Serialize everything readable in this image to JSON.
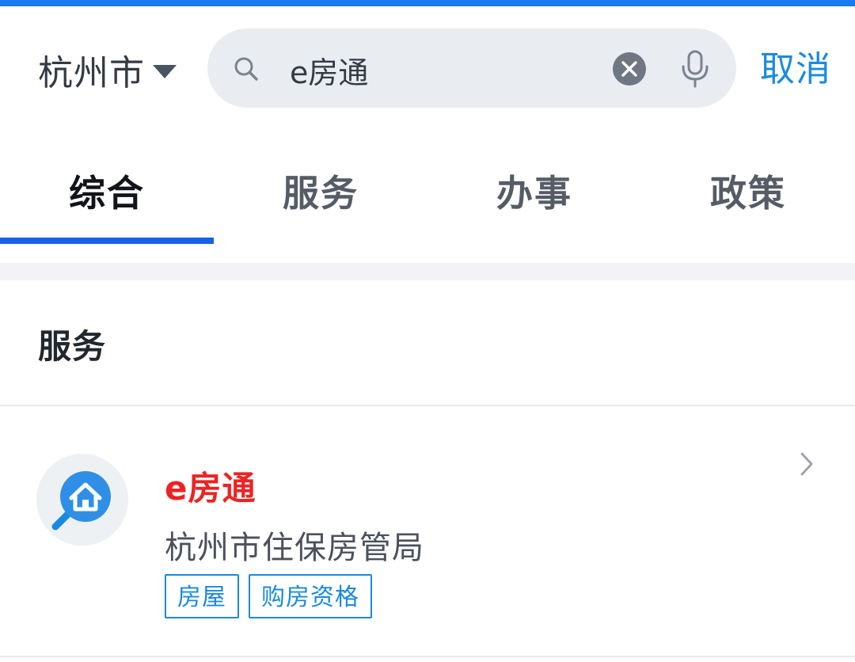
{
  "header": {
    "city": "杭州市",
    "search": {
      "value": "e房通"
    },
    "cancel_label": "取消"
  },
  "tabs": [
    {
      "label": "综合",
      "active": true
    },
    {
      "label": "服务",
      "active": false
    },
    {
      "label": "办事",
      "active": false
    },
    {
      "label": "政策",
      "active": false
    }
  ],
  "section": {
    "title": "服务"
  },
  "results": [
    {
      "name": "e房通",
      "provider": "杭州市住保房管局",
      "tags": [
        "房屋",
        "购房资格"
      ],
      "icon": "house-search-icon"
    }
  ],
  "colors": {
    "accent_blue": "#1760e8",
    "link_blue": "#1a8ae0",
    "highlight_red": "#ee2222",
    "top_strip": "#1a7cf0"
  }
}
